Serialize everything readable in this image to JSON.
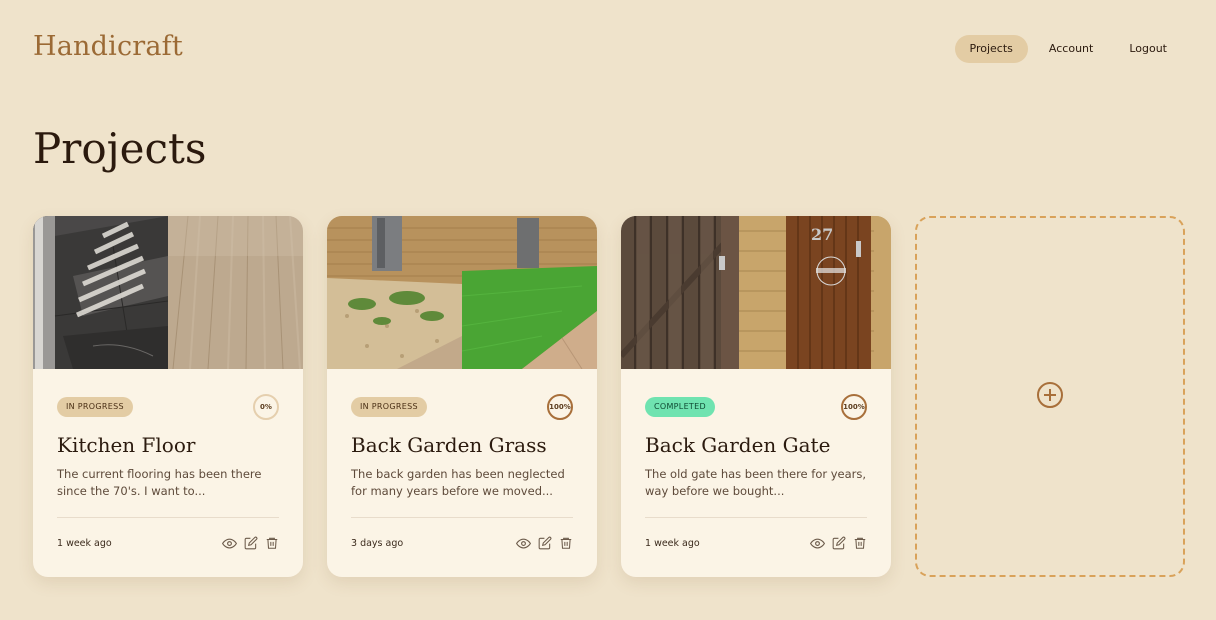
{
  "app": {
    "brand": "Handicraft"
  },
  "nav": [
    {
      "label": "Projects",
      "active": true
    },
    {
      "label": "Account",
      "active": false
    },
    {
      "label": "Logout",
      "active": false
    }
  ],
  "page": {
    "title": "Projects"
  },
  "cards": [
    {
      "status": "IN PROGRESS",
      "status_color": "#e3cca4",
      "progress_label": "0%",
      "progress": 0,
      "title": "Kitchen Floor",
      "description": "The current flooring has been there since the 70's. I want to...",
      "time_ago": "1 week ago",
      "photo_left": "dark tiled floor with sunlight stripes",
      "photo_right": "light oak plank flooring"
    },
    {
      "status": "IN PROGRESS",
      "status_color": "#e3cca4",
      "progress_label": "100%",
      "progress": 100,
      "title": "Back Garden Grass",
      "description": "The back garden has been neglected for many years before we moved...",
      "time_ago": "3 days ago",
      "photo_left": "gravel garden with weeds",
      "photo_right": "fresh green lawn with paving"
    },
    {
      "status": "COMPLETED",
      "status_color": "#6fe3b0",
      "progress_label": "100%",
      "progress": 100,
      "title": "Back Garden Gate",
      "description": "The old gate has been there for years, way before we bought...",
      "time_ago": "1 week ago",
      "photo_left": "weathered wooden gate with brick",
      "photo_right": "new wooden gate with number 27 and welcome sign"
    }
  ],
  "icons": {
    "view": "eye-icon",
    "edit": "edit-icon",
    "delete": "trash-icon",
    "add": "plus-circle-icon"
  },
  "colors": {
    "background": "#efe3cb",
    "brand": "#9b6a35",
    "accent": "#d9a25a",
    "card": "#fbf4e6"
  }
}
